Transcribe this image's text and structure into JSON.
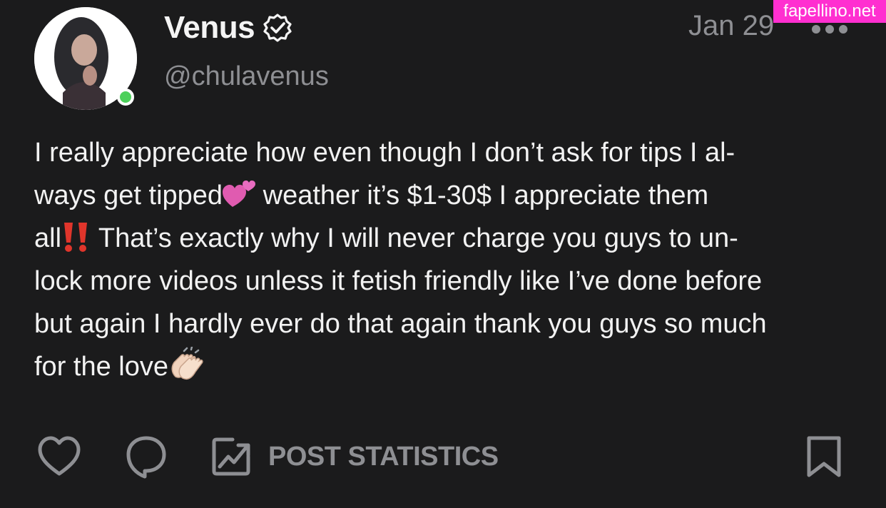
{
  "author": {
    "display_name": "Venus",
    "handle": "@chulavenus",
    "verified": true,
    "online": true
  },
  "post": {
    "date": "Jan 29",
    "lines": [
      "I really appreciate how even though I don’t ask for tips I al-",
      "ways get tipped",
      " weather it’s $1-30$ I appreciate them",
      "all",
      " That’s exactly why I will never charge you guys to un-",
      "lock more videos unless it fetish friendly like I’ve done before",
      "but again I hardly ever do that again thank you guys so much",
      "for the love"
    ],
    "emojis": [
      "two-hearts",
      "double-exclamation",
      "clapping-hands"
    ]
  },
  "actions": {
    "stats_label": "POST STATISTICS",
    "icons": [
      "heart-icon",
      "comment-icon",
      "chart-icon",
      "bookmark-icon"
    ]
  },
  "watermark": "fapellino.net",
  "colors": {
    "background": "#1b1b1c",
    "text": "#f2f2f2",
    "muted": "#8e8f93",
    "online": "#4cd05a",
    "watermark_bg": "#ff2fd0"
  }
}
